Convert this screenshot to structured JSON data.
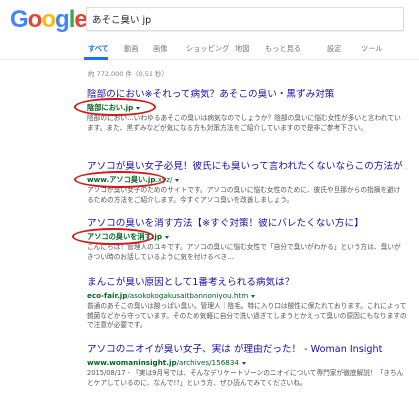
{
  "logo": {
    "letters": [
      {
        "ch": "G",
        "color": "#4285f4"
      },
      {
        "ch": "o",
        "color": "#ea4335"
      },
      {
        "ch": "o",
        "color": "#fbbc05"
      },
      {
        "ch": "g",
        "color": "#4285f4"
      },
      {
        "ch": "l",
        "color": "#34a853"
      },
      {
        "ch": "e",
        "color": "#ea4335"
      }
    ]
  },
  "search": {
    "value": "あそこ臭い jp"
  },
  "tabs": {
    "all": "すべて",
    "videos": "動画",
    "images": "画像",
    "shopping": "ショッピング",
    "maps": "地図",
    "more": "もっと見る",
    "settings": "設定",
    "tools": "ツール"
  },
  "stats": "約 772,000 件（0.51 秒）",
  "results": [
    {
      "title": "陰部のにおい※それって病気？あそこの臭い・黒ずみ対策",
      "url": "陰部におい.jp",
      "url_suffix": "",
      "snippet": "陰部のにおい…いわゆるあそこの臭いは病気なのでしょうか？陰部の臭いに悩む女性が多いと言われています。また、黒ずみなどが気になる方も対策方法をご紹介していますので是非ご参考下さい。"
    },
    {
      "title": "アソコが臭い女子必見！彼氏にも臭いって言われたくないならこの方法が …",
      "url": "www.アソコ臭い.jp",
      "url_suffix": ".xyz/",
      "snippet": "アソコが臭い女子のためのサイトです。アソコの臭いに悩む女性のために、彼氏や旦那からの指摘を避けるための方法をご紹介します。今すぐアソコ臭いを改善しましょう。"
    },
    {
      "title": "アソコの臭いを消す方法【※すぐ対策！彼にバレたくない方に】",
      "url": "アソコの臭いを消す.jp",
      "url_suffix": "",
      "snippet": "こんにちは！管理人のユキです。アソコの臭いに悩む女性で「自分で臭いがわかる」という方は、臭いがきつい時のお話しているように気を付けるべき…"
    },
    {
      "title": "まんこが臭い原因として1番考えられる病気は？",
      "url": "eco-fair.jp",
      "url_suffix": "/asokokogakusaitbannoniyou.htm",
      "snippet": "普通のあそこの臭いは酸っぱい臭い。管理人｜陰毛。特に入り口は酸性に保たれております。これによって雑菌などから守っています。そのため気軽に自分で洗い過ぎてしまうとかえって臭いの原因にもなりますので注意が必要です。"
    },
    {
      "title": "アソコのニオイが臭い女子、実は が理由だった！ - Woman Insight",
      "url": "www.womaninsight.jp",
      "url_suffix": "/archives/156834",
      "snippet": "2015/08/17 - 『実は9月号では、そんなデリケートゾーンのニオイについて専門家が徹底解説！「きちんとケアしているのに、なんで!?」という方、ぜひ読んでみてくださいね。"
    }
  ]
}
